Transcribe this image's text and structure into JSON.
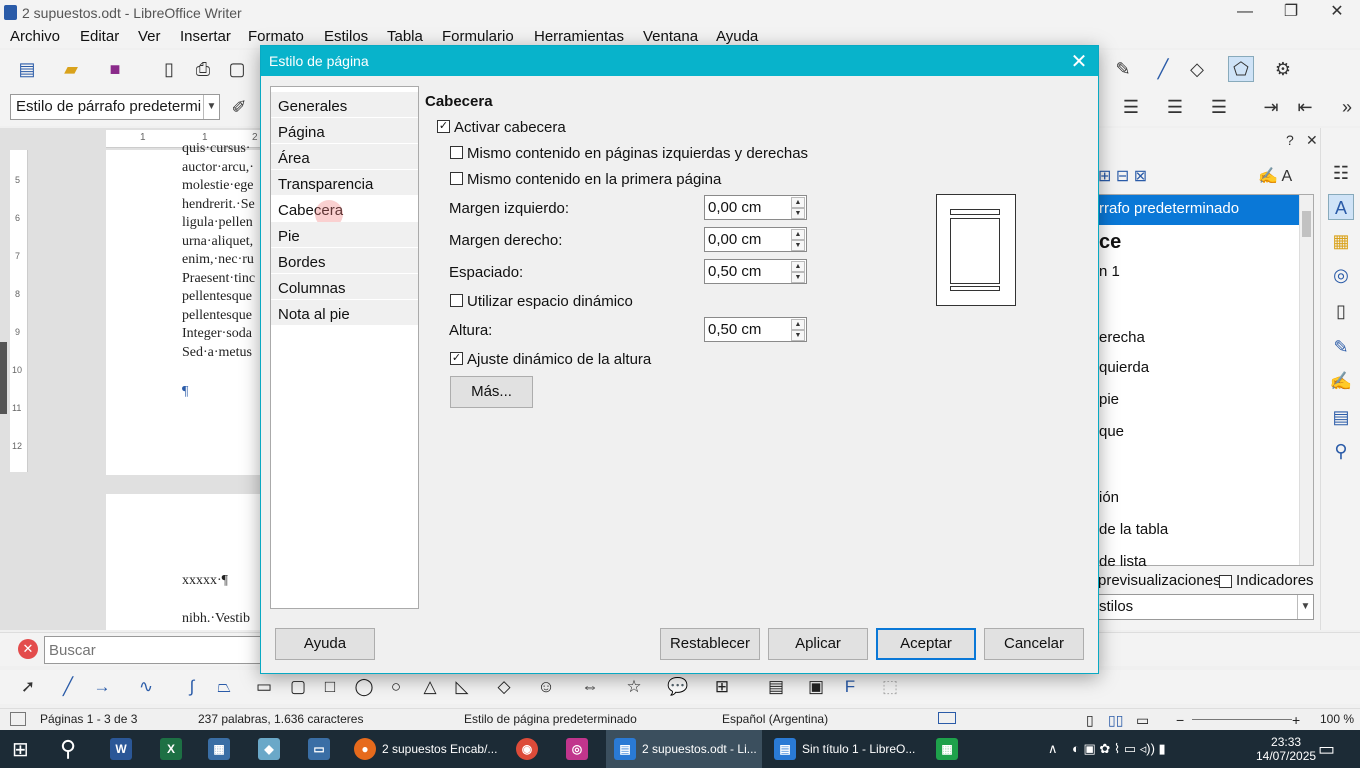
{
  "window": {
    "title": "2 supuestos.odt - LibreOffice Writer"
  },
  "menu": [
    "Archivo",
    "Editar",
    "Ver",
    "Insertar",
    "Formato",
    "Estilos",
    "Tabla",
    "Formulario",
    "Herramientas",
    "Ventana",
    "Ayuda"
  ],
  "toolbar": {
    "paragraph_style": "Estilo de párrafo predetermi"
  },
  "ruler": {
    "h_ticks": [
      "1",
      "1",
      "2"
    ],
    "v_ticks": [
      "5",
      "6",
      "7",
      "8",
      "9",
      "10",
      "11",
      "12"
    ]
  },
  "document": {
    "page1_lines": [
      "quis·cursus·",
      "auctor·arcu,·",
      "molestie·ege",
      "hendrerit.·Se",
      "ligula·pellen",
      "urna·aliquet,",
      "enim,·nec·ru",
      "Praesent·tinc",
      "pellentesque",
      "pellentesque",
      "Integer·soda",
      "Sed·a·metus"
    ],
    "pilcrow": "¶",
    "page2_line1": "xxxxx·¶",
    "page2_line2": "nibh.·Vestib"
  },
  "sidebar": {
    "selected": "rrafo predeterminado",
    "items": [
      "ce",
      "n 1",
      "erecha",
      "quierda",
      "pie",
      "que",
      "ión",
      "de la tabla",
      "de lista"
    ],
    "previews_label": "previsualizaciones",
    "indicators_label": "Indicadores",
    "filter_value": "stilos"
  },
  "find": {
    "placeholder": "Buscar"
  },
  "status": {
    "pages": "Páginas 1 - 3 de 3",
    "words": "237 palabras, 1.636 caracteres",
    "page_style": "Estilo de página predeterminado",
    "language": "Español (Argentina)",
    "zoom": "100 %"
  },
  "taskbar": {
    "firefox": "2 supuestos Encab/...",
    "writer_active": "2 supuestos.odt - Li...",
    "writer_untitled": "Sin título 1 - LibreO...",
    "time": "23:33",
    "date": "14/07/2025"
  },
  "dialog": {
    "title": "Estilo de página",
    "nav": [
      "Generales",
      "Página",
      "Área",
      "Transparencia",
      "Cabecera",
      "Pie",
      "Bordes",
      "Columnas",
      "Nota al pie"
    ],
    "nav_selected_index": 4,
    "section": "Cabecera",
    "activate_header": {
      "label": "Activar cabecera",
      "checked": true
    },
    "same_lr": {
      "label": "Mismo contenido en páginas izquierdas y derechas",
      "checked": false
    },
    "same_first": {
      "label": "Mismo contenido en la primera página",
      "checked": false
    },
    "left_margin": {
      "label": "Margen izquierdo:",
      "value": "0,00 cm"
    },
    "right_margin": {
      "label": "Margen derecho:",
      "value": "0,00 cm"
    },
    "spacing": {
      "label": "Espaciado:",
      "value": "0,50 cm"
    },
    "dynamic_spacing": {
      "label": "Utilizar espacio dinámico",
      "checked": false
    },
    "height": {
      "label": "Altura:",
      "value": "0,50 cm"
    },
    "autofit": {
      "label": "Ajuste dinámico de la altura",
      "checked": true
    },
    "more_button": "Más...",
    "buttons": {
      "help": "Ayuda",
      "reset": "Restablecer",
      "apply": "Aplicar",
      "ok": "Aceptar",
      "cancel": "Cancelar"
    }
  },
  "colors": {
    "dialog_title": "#08b3cb",
    "selection": "#0a78d7",
    "taskbar": "#1c2b36"
  }
}
